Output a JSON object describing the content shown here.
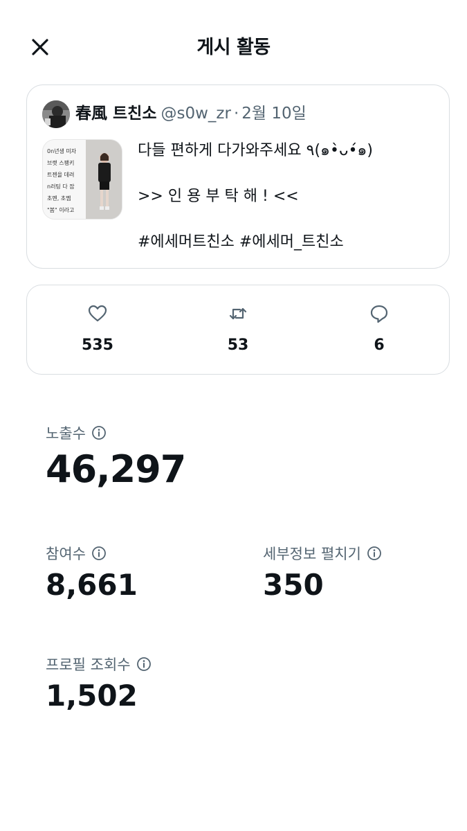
{
  "header": {
    "title": "게시 활동",
    "close_icon": "close-icon"
  },
  "post": {
    "author_name": "春風 트친소",
    "handle": "@s0w_zr",
    "separator": "·",
    "date": "2월 10일",
    "lines": [
      "다들 편하게 다가와주세요 ٩(๑•̀ᴗ•́๑)",
      ">> 인 용 부 탁 해 ! <<",
      "#에세머트친소 #에세머_트친소"
    ],
    "thumbnail_lines": [
      "0n년생 미자",
      "브랫 스팽키",
      "트젠을 데려",
      "n러팅 다 잡",
      "초멘, 초멤",
      "\"봄\" 이라고"
    ]
  },
  "engagement": {
    "likes": "535",
    "retweets": "53",
    "replies": "6",
    "icons": [
      "heart-icon",
      "retweet-icon",
      "reply-icon"
    ]
  },
  "metrics": {
    "impressions": {
      "label": "노출수",
      "value": "46,297"
    },
    "engagements": {
      "label": "참여수",
      "value": "8,661"
    },
    "detail_expands": {
      "label": "세부정보 펼치기",
      "value": "350"
    },
    "profile_visits": {
      "label": "프로필 조회수",
      "value": "1,502"
    }
  },
  "colors": {
    "text_primary": "#0f1419",
    "text_secondary": "#536471",
    "border": "#d9dde1"
  }
}
